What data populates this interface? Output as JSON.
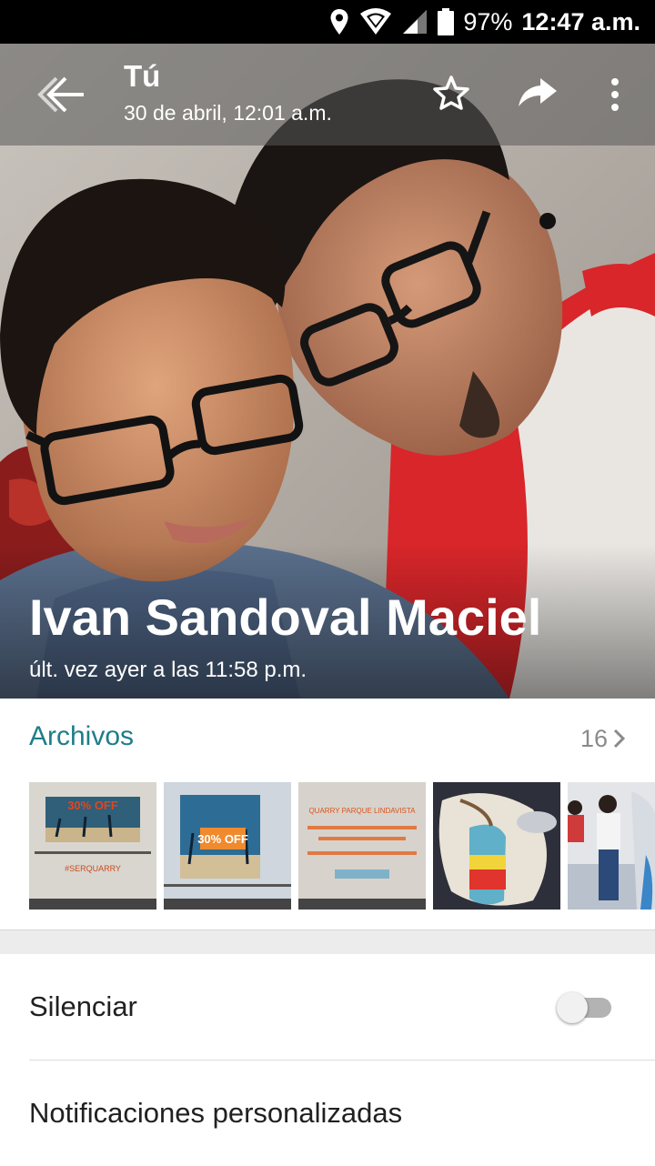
{
  "status_bar": {
    "battery": "97%",
    "time": "12:47 a.m.",
    "icons": [
      "location-icon",
      "wifi-icon",
      "signal-icon",
      "battery-icon"
    ]
  },
  "header": {
    "title": "Tú",
    "subtitle": "30 de abril, 12:01 a.m.",
    "icons": [
      "back-arrow-icon",
      "star-icon",
      "share-icon",
      "more-vert-icon"
    ]
  },
  "contact": {
    "name": "Ivan Sandoval Maciel",
    "last_seen": "últ. vez ayer a las 11:58 p.m."
  },
  "media": {
    "title": "Archivos",
    "count": "16",
    "thumbnails": [
      {
        "label": "30% OFF",
        "caption": "#SERQUARRY",
        "theme": "promo-beach"
      },
      {
        "label": "30% OFF",
        "caption": "",
        "theme": "promo-beach"
      },
      {
        "label": "QUARRY PARQUE LINDAVISTA",
        "caption": "",
        "theme": "promo-text"
      },
      {
        "label": "",
        "caption": "",
        "theme": "art"
      },
      {
        "label": "",
        "caption": "",
        "theme": "photo"
      }
    ]
  },
  "settings": {
    "mute_label": "Silenciar",
    "mute_enabled": false,
    "custom_notifications_label": "Notificaciones personalizadas"
  },
  "colors": {
    "accent": "#1f7d8a",
    "status_bar": "#000000",
    "divider": "#dcdcdc"
  }
}
